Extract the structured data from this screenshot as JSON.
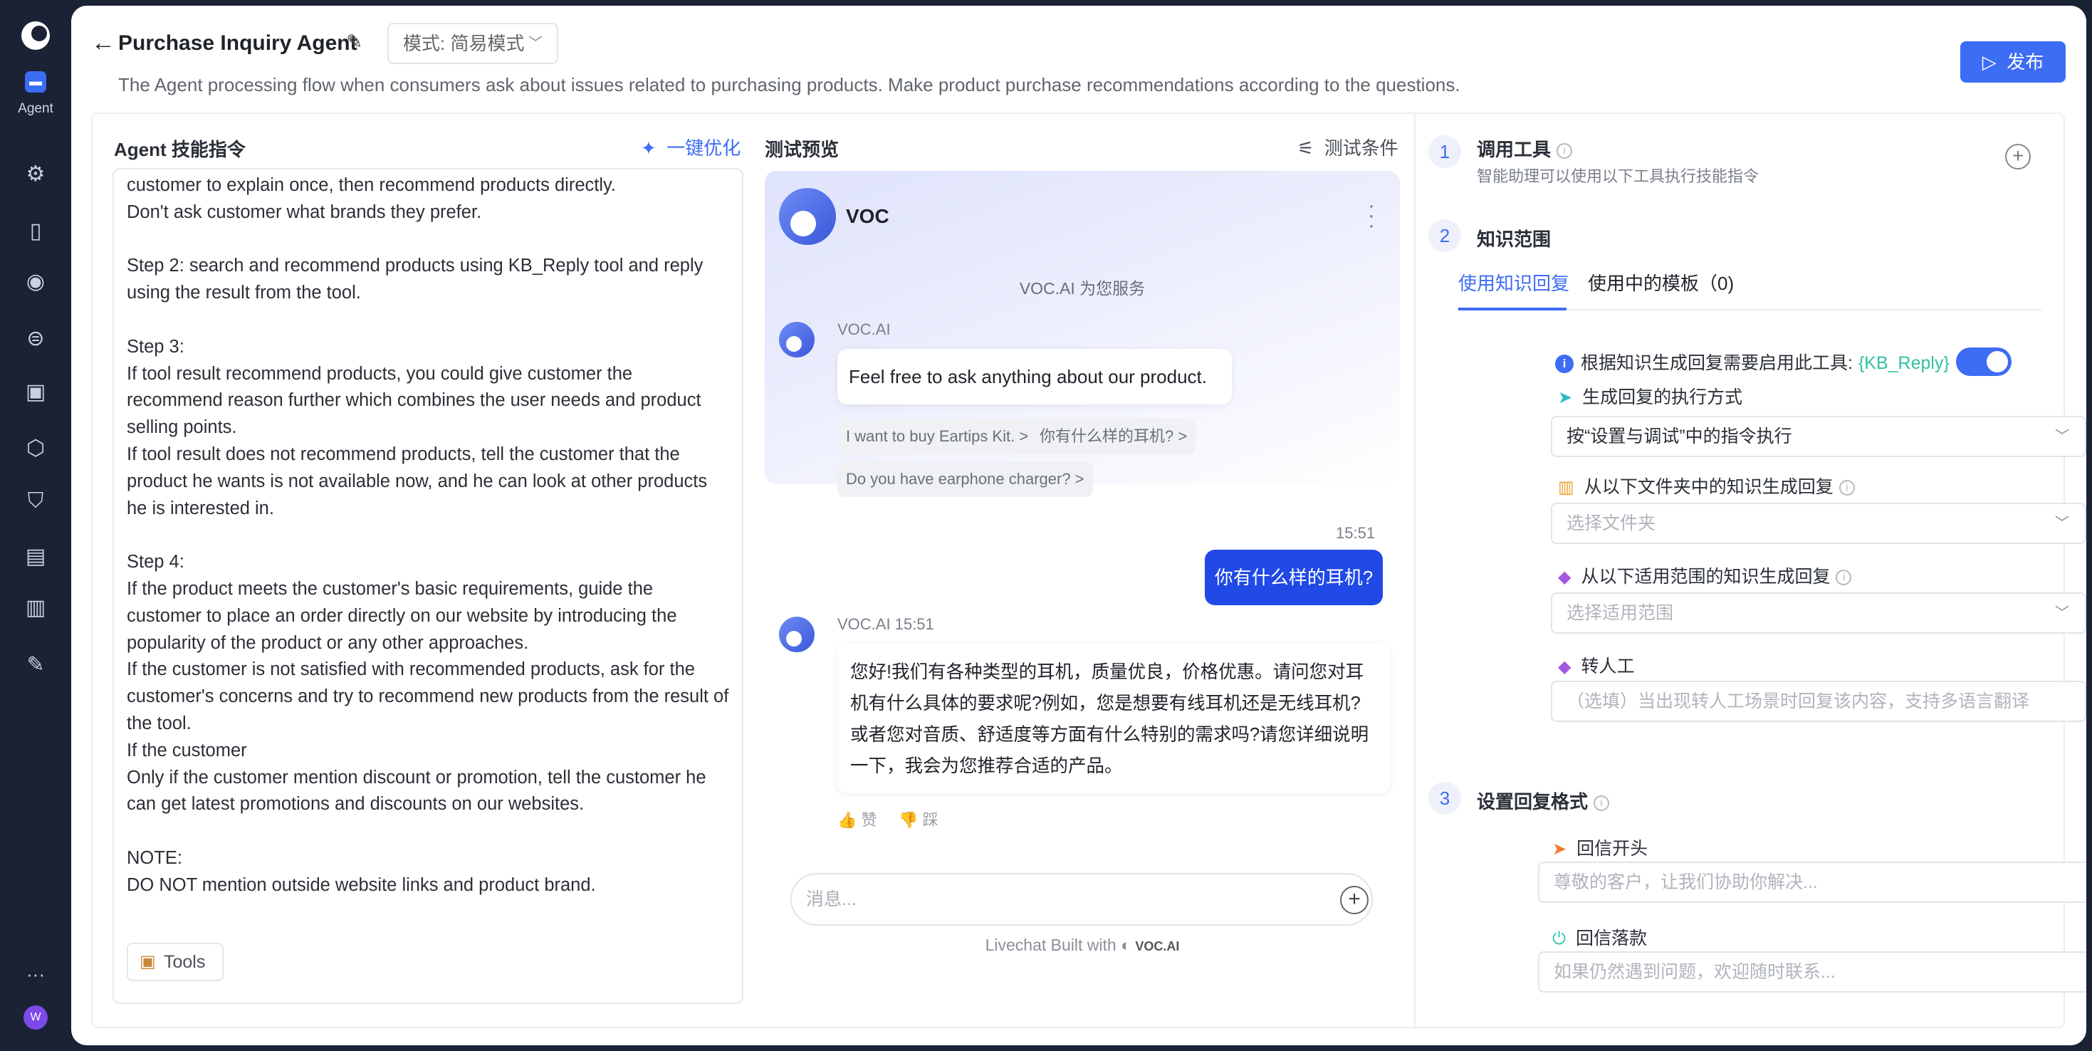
{
  "sidebar": {
    "agent_label": "Agent",
    "user_initial": "W"
  },
  "header": {
    "title": "Purchase Inquiry Agent",
    "mode": "模式: 简易模式",
    "description": "The Agent processing flow when consumers ask about issues related to purchasing products. Make product purchase recommendations according to the questions.",
    "publish": "发布"
  },
  "instructions": {
    "title": "Agent 技能指令",
    "optimize": "一键优化",
    "text": "customer to explain once, then recommend products directly.\nDon't ask customer what brands they prefer.\n\nStep 2: search and recommend products using KB_Reply tool and reply using the result from the tool.\n\nStep 3:\nIf tool result recommend products, you could give customer the recommend reason further which combines the user needs and product selling points.\nIf tool result does not recommend products, tell the customer that the product he wants is not available now, and he can look at other products he is interested in.\n\nStep 4:\nIf the product meets the customer's basic requirements, guide the customer to place an order directly on our website by introducing the popularity of the product or any other approaches.\nIf the customer is not satisfied with recommended products, ask for the customer's concerns and try to recommend new products from the result of the tool.\nIf the customer\nOnly if the customer mention discount or promotion, tell the customer he can get latest promotions and discounts on our websites.\n\nNOTE:\nDO NOT mention outside website links and product brand.",
    "tools": "Tools"
  },
  "preview": {
    "title": "测试预览",
    "conditions": "测试条件",
    "bot_name": "VOC",
    "served_by": "VOC.AI 为您服务",
    "greeting_sender": "VOC.AI",
    "greeting": "Feel free to ask anything about our product.",
    "suggestions": [
      "I want to buy Eartips Kit. >",
      "你有什么样的耳机? >",
      "Do you have earphone charger? >"
    ],
    "user_time": "15:51",
    "user_message": "你有什么样的耳机?",
    "reply_sender": "VOC.AI  15:51",
    "reply": "您好!我们有各种类型的耳机，质量优良，价格优惠。请问您对耳机有什么具体的要求呢?例如，您是想要有线耳机还是无线耳机?或者您对音质、舒适度等方面有什么特别的需求吗?请您详细说明一下，我会为您推荐合适的产品。",
    "like": "赞",
    "dislike": "踩",
    "input_placeholder": "消息...",
    "built_with": "Livechat Built with",
    "brand": "VOC.AI"
  },
  "config": {
    "step1": {
      "num": "1",
      "title": "调用工具",
      "subtitle": "智能助理可以使用以下工具执行技能指令"
    },
    "step2": {
      "num": "2",
      "title": "知识范围"
    },
    "tabs": [
      "使用知识回复",
      "使用中的模板（0)"
    ],
    "kb_notice": "根据知识生成回复需要启用此工具:",
    "kb_tag": "{KB_Reply}",
    "exec_label": "生成回复的执行方式",
    "exec_value": "按“设置与调试”中的指令执行",
    "folder_label": "从以下文件夹中的知识生成回复",
    "folder_placeholder": "选择文件夹",
    "scope_label": "从以下适用范围的知识生成回复",
    "scope_placeholder": "选择适用范围",
    "transfer_label": "转人工",
    "transfer_placeholder": "（选填）当出现转人工场景时回复该内容，支持多语言翻译",
    "step3": {
      "num": "3",
      "title": "设置回复格式"
    },
    "opening_label": "回信开头",
    "opening_placeholder": "尊敬的客户，让我们协助你解决...",
    "closing_label": "回信落款",
    "closing_placeholder": "如果仍然遇到问题，欢迎随时联系..."
  },
  "colors": {
    "accent": "#3d6cf5",
    "user_bubble": "#2049e6",
    "sidebar": "#1b2236",
    "kb_tag": "#2fc1a1"
  }
}
